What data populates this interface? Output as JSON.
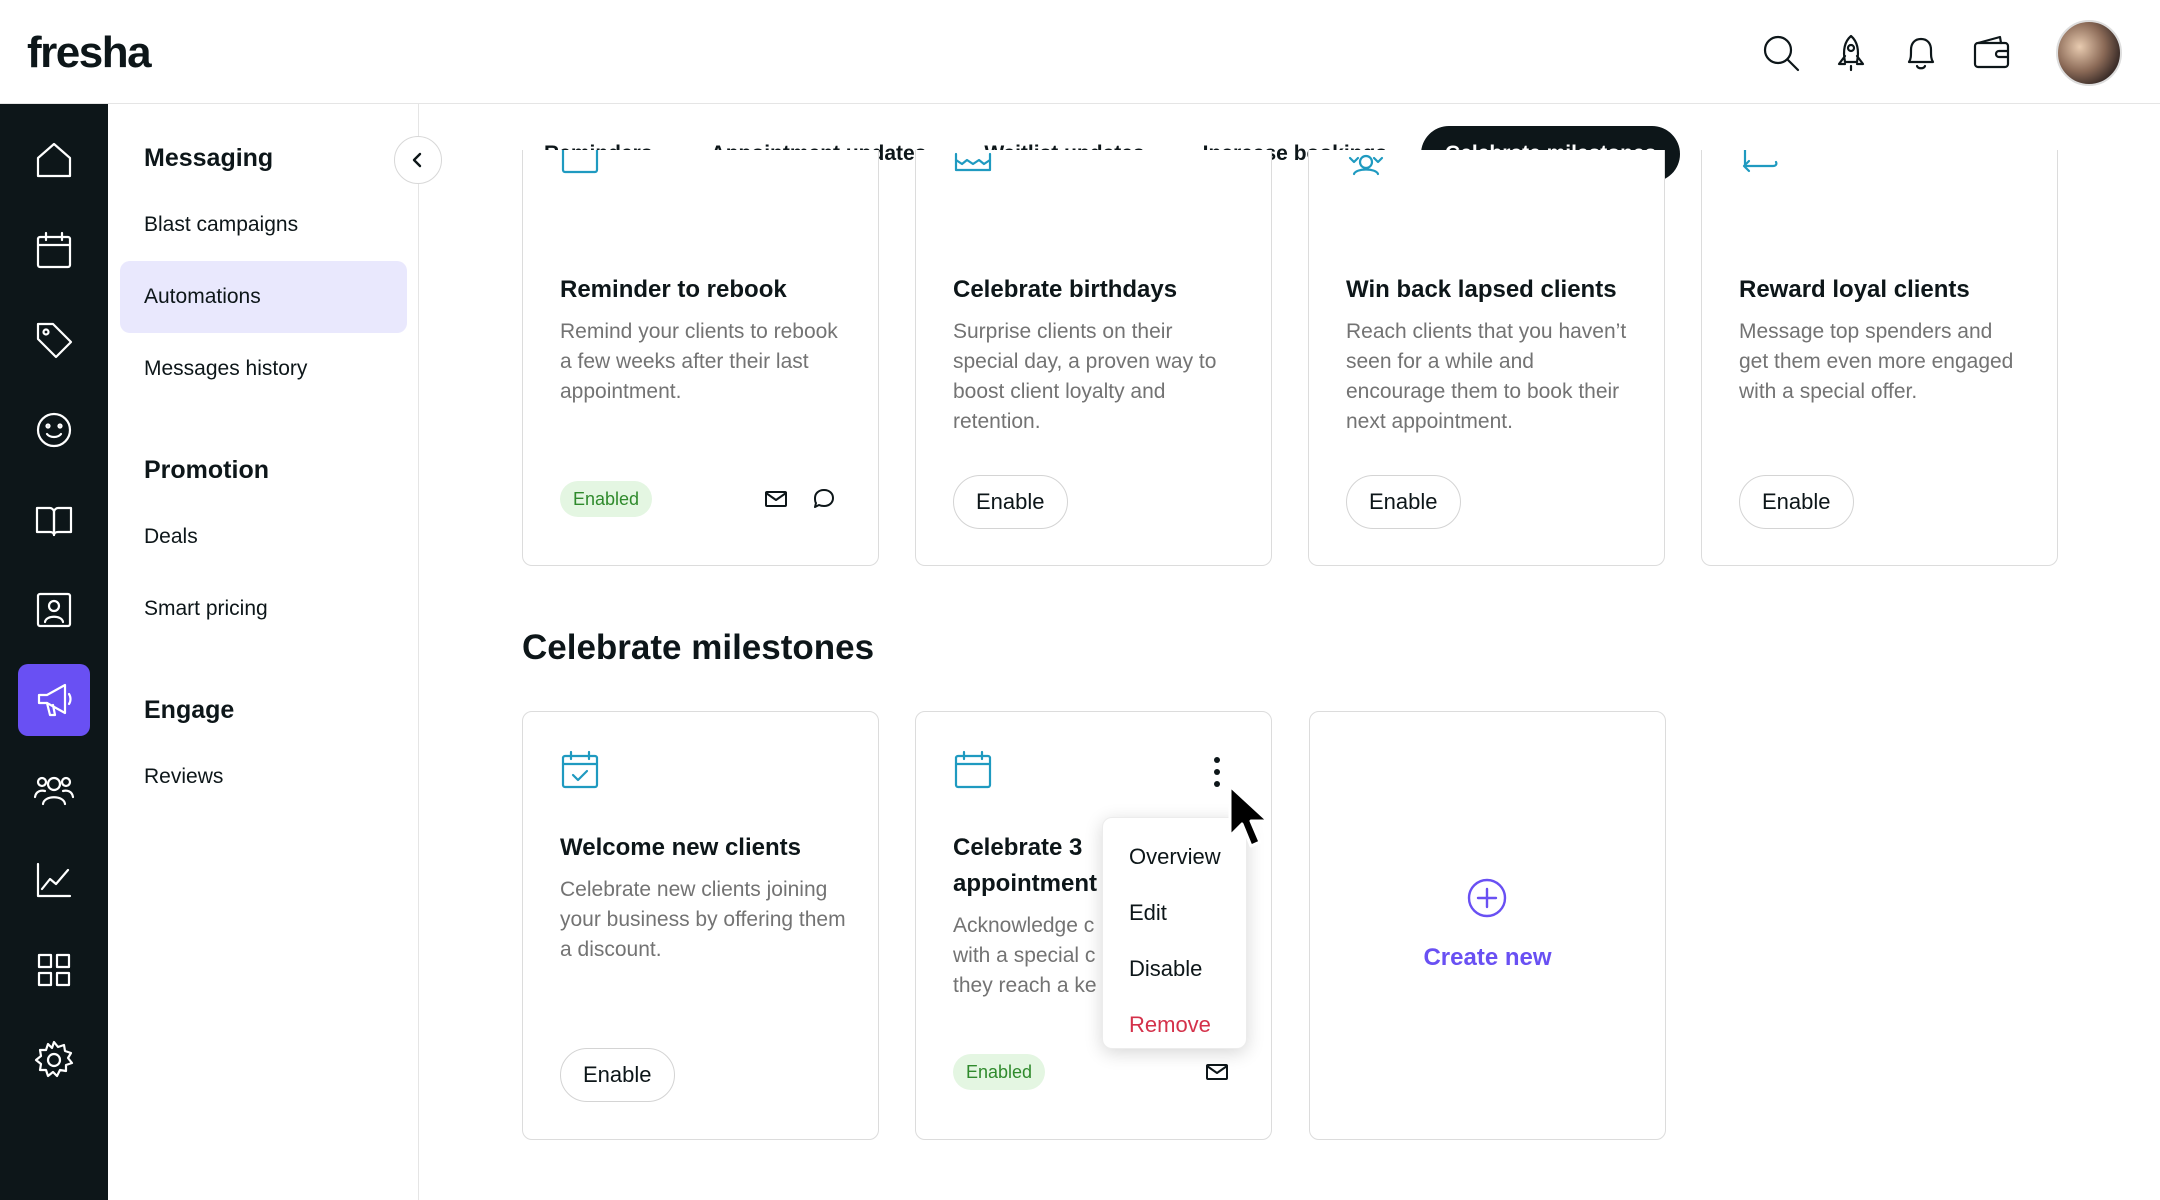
{
  "app": {
    "logo": "fresha"
  },
  "topbar": {
    "icons": [
      "search-icon",
      "rocket-icon",
      "bell-icon",
      "wallet-icon"
    ],
    "avatar": "user-avatar"
  },
  "rail": {
    "items": [
      "home-icon",
      "calendar-icon",
      "tag-icon",
      "smiley-icon",
      "book-icon",
      "contact-card-icon",
      "megaphone-icon",
      "team-icon",
      "analytics-icon",
      "apps-grid-icon",
      "settings-icon"
    ],
    "active": "megaphone-icon",
    "accent": "#6950f3"
  },
  "sidebar": {
    "sections": [
      {
        "title": "Messaging",
        "items": [
          "Blast campaigns",
          "Automations",
          "Messages history"
        ]
      },
      {
        "title": "Promotion",
        "items": [
          "Deals",
          "Smart pricing"
        ]
      },
      {
        "title": "Engage",
        "items": [
          "Reviews"
        ]
      }
    ],
    "active_item": "Automations"
  },
  "tabs": [
    "Reminders",
    "Appointment updates",
    "Waitlist updates",
    "Increase bookings",
    "Celebrate milestones"
  ],
  "active_tab": "Celebrate milestones",
  "top_cards": [
    {
      "icon": "calendar-icon",
      "title": "Reminder to rebook",
      "desc": "Remind your clients to rebook a few weeks after their last appointment.",
      "status": "Enabled",
      "channels": [
        "mail-icon",
        "chat-icon"
      ]
    },
    {
      "icon": "cake-icon",
      "title": "Celebrate birthdays",
      "desc": "Surprise clients on their special day, a proven way to boost client loyalty and retention.",
      "button": "Enable"
    },
    {
      "icon": "people-icon",
      "title": "Win back lapsed clients",
      "desc": "Reach clients that you haven’t seen for a while and encourage them to book their next appointment.",
      "button": "Enable"
    },
    {
      "icon": "return-arrow-icon",
      "title": "Reward loyal clients",
      "desc": "Message top spenders and get them even more engaged with a special offer.",
      "button": "Enable"
    }
  ],
  "milestones": {
    "title": "Celebrate milestones",
    "cards": [
      {
        "icon": "calendar-check-icon",
        "title": "Welcome new clients",
        "desc": "Celebrate new clients joining your business by offering them a discount.",
        "button": "Enable"
      },
      {
        "icon": "calendar-icon",
        "title_line1": "Celebrate 3",
        "title_line2": "appointment",
        "desc_lines": [
          "Acknowledge c",
          "with a special c",
          "they reach a ke"
        ],
        "status": "Enabled",
        "channels": [
          "mail-icon"
        ]
      }
    ],
    "create_new": "Create new"
  },
  "context_menu": {
    "items": [
      "Overview",
      "Edit",
      "Disable",
      "Remove"
    ],
    "danger_color": "#d4314a"
  },
  "colors": {
    "brand_dark": "#0d1619",
    "accent_purple": "#6950f3",
    "icon_teal": "#1f9ac0",
    "enabled_green": "#2f8a2c",
    "enabled_bg": "#e4f6e2",
    "active_nav_bg": "#e9e8fd"
  }
}
